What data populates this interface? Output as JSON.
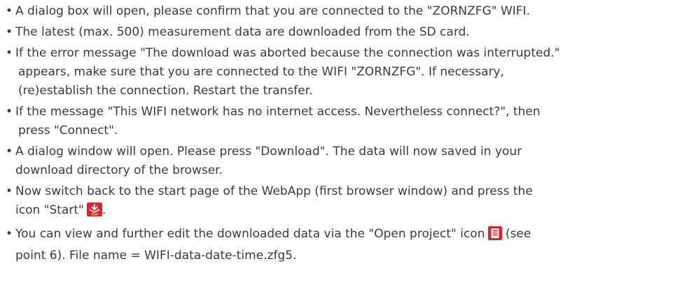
{
  "instructions": {
    "bullet_glyph": "•",
    "items": [
      {
        "lines": [
          "A dialog box will open, please confirm that you are connected to the \"ZORNZFG\" WIFI."
        ]
      },
      {
        "lines": [
          "The latest (max. 500) measurement data are downloaded from the SD card."
        ]
      },
      {
        "lines": [
          "If the error message \"The download was aborted because the connection was interrupted.\"",
          "appears, make sure that you are connected to the WIFI \"ZORNZFG\". If necessary,",
          "(re)establish the connection. Restart the transfer."
        ]
      },
      {
        "lines": [
          "If the message \"This WIFI network has no internet access. Nevertheless connect?\", then",
          "press \"Connect\"."
        ]
      },
      {
        "lines": [
          "A dialog window will open. Please press \"Download\". The data will now saved in your",
          "download directory of the browser."
        ]
      },
      {
        "lines": [
          "Now switch back to the start page of the WebApp (first browser window) and press the",
          "icon \"Start\"",
          "."
        ],
        "icon": {
          "name": "start-icon",
          "label": "Start",
          "color": "#d9262b"
        }
      },
      {
        "lines": [
          "You can view and further edit the downloaded data via the \"Open project\" icon",
          "(see",
          "point 6). File name = WIFI-data-date-time.zfg5."
        ],
        "icon": {
          "name": "open-project-icon",
          "color": "#d9262b"
        }
      }
    ]
  }
}
